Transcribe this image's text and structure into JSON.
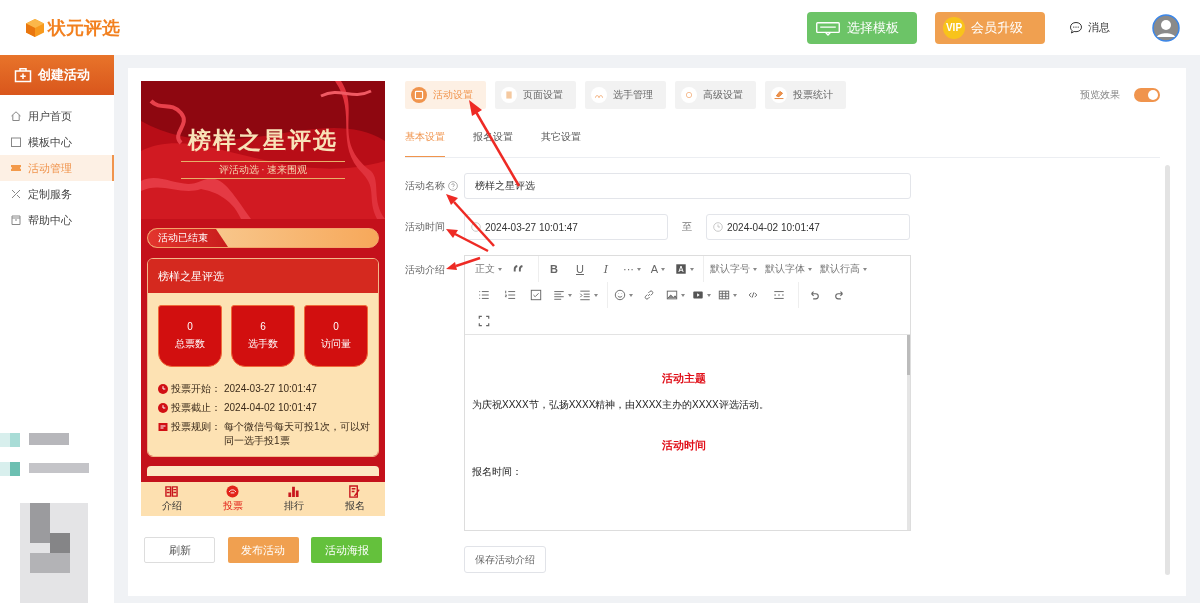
{
  "header": {
    "logo": "状元评选",
    "buttons": [
      {
        "kind": "template",
        "label": "选择模板"
      },
      {
        "kind": "vip",
        "label": "会员升级",
        "badge": "VIP"
      }
    ],
    "messages": "消息"
  },
  "sidebar": {
    "create": "创建活动",
    "items": [
      {
        "label": "用户首页",
        "selected": false
      },
      {
        "label": "模板中心",
        "selected": false
      },
      {
        "label": "活动管理",
        "selected": true
      },
      {
        "label": "定制服务",
        "selected": false
      },
      {
        "label": "帮助中心",
        "selected": false
      }
    ]
  },
  "preview": {
    "banner_title": "榜样之星评选",
    "banner_subtitle": "评活动选 · 速来围观",
    "status": "活动已结束",
    "card_title": "榜样之星评选",
    "stats": [
      {
        "value": "0",
        "label": "总票数"
      },
      {
        "value": "6",
        "label": "选手数"
      },
      {
        "value": "0",
        "label": "访问量"
      }
    ],
    "info": [
      {
        "kind": "time",
        "label": "投票开始：",
        "value": "2024-03-27 10:01:47"
      },
      {
        "kind": "time",
        "label": "投票截止：",
        "value": "2024-04-02 10:01:47"
      },
      {
        "kind": "rule",
        "label": "投票规则：",
        "value": "每个微信号每天可投1次，可以对同一选手投1票"
      }
    ],
    "nav": [
      {
        "label": "介绍",
        "selected": false
      },
      {
        "label": "投票",
        "selected": true
      },
      {
        "label": "排行",
        "selected": false
      },
      {
        "label": "报名",
        "selected": false
      }
    ]
  },
  "preview_buttons": [
    {
      "kind": "plain",
      "label": "刷新"
    },
    {
      "kind": "primary",
      "label": "发布活动"
    },
    {
      "kind": "success",
      "label": "活动海报"
    }
  ],
  "tabs": [
    {
      "label": "活动设置",
      "selected": true
    },
    {
      "label": "页面设置",
      "selected": false
    },
    {
      "label": "选手管理",
      "selected": false
    },
    {
      "label": "高级设置",
      "selected": false
    },
    {
      "label": "投票统计",
      "selected": false
    }
  ],
  "preview_toggle": {
    "label": "预览效果",
    "on": true
  },
  "subtabs": [
    {
      "label": "基本设置",
      "selected": true
    },
    {
      "label": "报名设置",
      "selected": false
    },
    {
      "label": "其它设置",
      "selected": false
    }
  ],
  "form": {
    "name_label": "活动名称",
    "name_value": "榜样之星评选",
    "time_label": "活动时间",
    "start": "2024-03-27 10:01:47",
    "to": "至",
    "end": "2024-04-02 10:01:47",
    "intro_label": "活动介绍"
  },
  "editor": {
    "toolbar": [
      [
        [
          {
            "kind": "select",
            "label": "正文"
          },
          {
            "kind": "icon",
            "caret": false
          }
        ],
        [
          {
            "kind": "glyph",
            "label": "B",
            "caret": false
          },
          {
            "kind": "glyph",
            "label": "U",
            "caret": false
          },
          {
            "kind": "glyph",
            "label": "I",
            "caret": false
          },
          {
            "kind": "glyph",
            "label": "···",
            "caret": true
          },
          {
            "kind": "glyph",
            "label": "A",
            "caret": true
          },
          {
            "kind": "icon",
            "caret": true
          }
        ],
        [
          {
            "kind": "select",
            "label": "默认字号"
          },
          {
            "kind": "select",
            "label": "默认字体"
          },
          {
            "kind": "select",
            "label": "默认行高"
          }
        ]
      ],
      [
        [
          {
            "kind": "icon",
            "caret": false
          },
          {
            "kind": "icon",
            "caret": false
          },
          {
            "kind": "icon",
            "caret": false
          },
          {
            "kind": "icon",
            "caret": true
          },
          {
            "kind": "icon",
            "caret": true
          }
        ],
        [
          {
            "kind": "icon",
            "caret": true
          },
          {
            "kind": "icon",
            "caret": false
          },
          {
            "kind": "icon",
            "caret": true
          },
          {
            "kind": "icon",
            "caret": true
          },
          {
            "kind": "icon",
            "caret": true
          },
          {
            "kind": "icon",
            "caret": false
          },
          {
            "kind": "icon",
            "caret": false
          }
        ],
        [
          {
            "kind": "icon",
            "caret": false
          },
          {
            "kind": "icon",
            "caret": false
          }
        ]
      ],
      [
        [
          {
            "kind": "icon",
            "caret": false
          }
        ]
      ]
    ],
    "content": [
      {
        "kind": "heading",
        "text": "活动主题"
      },
      {
        "kind": "para",
        "text": "为庆祝XXXX节，弘扬XXXX精神，由XXXX主办的XXXX评选活动。"
      },
      {
        "kind": "heading",
        "text": "活动时间"
      },
      {
        "kind": "para",
        "text": "报名时间："
      }
    ]
  },
  "save_button": "保存活动介绍"
}
